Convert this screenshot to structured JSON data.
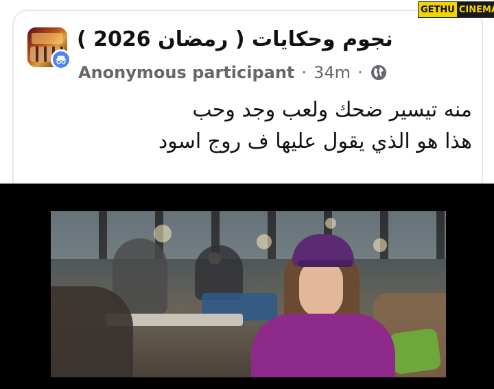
{
  "post": {
    "group_name": "نجوم وحكايات ( رمضان 2026 )",
    "author": "Anonymous participant",
    "separator": "·",
    "time": "34m",
    "audience_icon": "globe-icon",
    "avatar_icon": "anonymous-badge-icon",
    "text_lines": [
      "منه تيسير ضحك ولعب وجد وحب",
      "هذا هو الذي يقول عليها ف روج اسود"
    ]
  },
  "video": {
    "subject": "video-still"
  },
  "watermark": {
    "left": "GETHU",
    "right": "CINEMA"
  },
  "colors": {
    "meta_gray": "#65676b",
    "badge_blue": "#4c84f0",
    "watermark_yellow": "#f2d400"
  }
}
